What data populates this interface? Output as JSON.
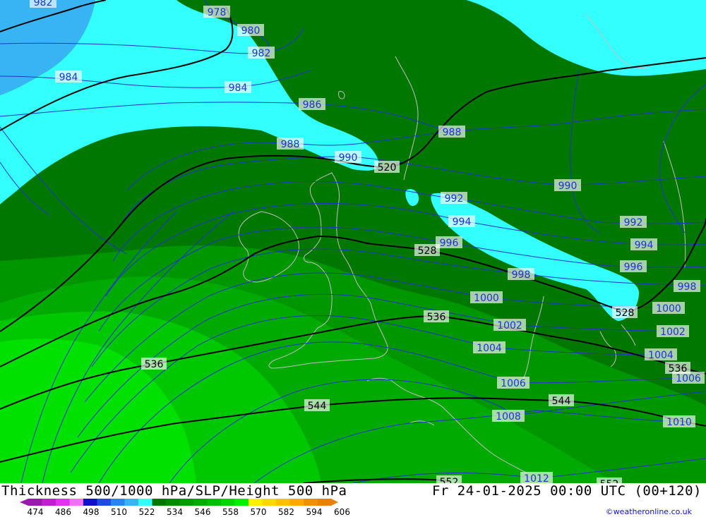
{
  "title": "Thickness 500/1000 hPa/SLP/Height 500 hPa",
  "datetime": "Fr 24-01-2025 00:00 UTC (00+120)",
  "credit": "©weatheronline.co.uk",
  "colors": {
    "cyan": "#33ffff",
    "light_blue": "#38b4f4",
    "dark_green": "#007800",
    "mid_green": "#009600",
    "green": "#00aa00",
    "bright_green": "#00c800",
    "lime": "#00e100",
    "isobar": "#2233cc",
    "height_line": "#000000",
    "coastline": "#bfbfbf"
  },
  "legend": {
    "labels": [
      "474",
      "486",
      "498",
      "510",
      "522",
      "534",
      "546",
      "558",
      "570",
      "582",
      "594",
      "606"
    ],
    "colors": [
      "#9a1ab0",
      "#c020d0",
      "#e030f0",
      "#f070f8",
      "#1010c8",
      "#1f4be0",
      "#2a85f0",
      "#38b4f4",
      "#33ffff",
      "#007800",
      "#008c00",
      "#009c00",
      "#00ac00",
      "#00c000",
      "#00d800",
      "#00f000",
      "#fff000",
      "#ffd800",
      "#ffc000",
      "#ffa800",
      "#f09000",
      "#e88000"
    ]
  },
  "isobar_labels": [
    "978",
    "980",
    "982",
    "982",
    "984",
    "984",
    "986",
    "988",
    "988",
    "990",
    "990",
    "992",
    "992",
    "994",
    "994",
    "996",
    "996",
    "998",
    "998",
    "1000",
    "1000",
    "1002",
    "1002",
    "1004",
    "1004",
    "1006",
    "1006",
    "1008",
    "1010",
    "1012"
  ],
  "height_labels": [
    "520",
    "528",
    "528",
    "536",
    "536",
    "536",
    "544",
    "544",
    "552",
    "552"
  ]
}
